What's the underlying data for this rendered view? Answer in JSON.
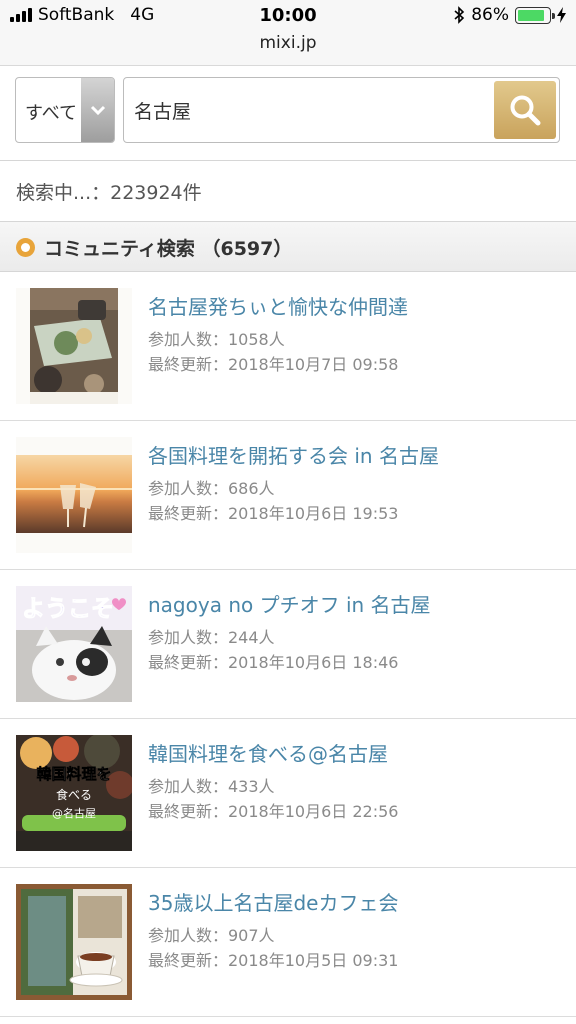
{
  "status_bar": {
    "carrier": "SoftBank",
    "network": "4G",
    "time": "10:00",
    "battery": "86%",
    "battery_level": 0.86,
    "url": "mixi.jp"
  },
  "search": {
    "scope": "すべて",
    "query": "名古屋",
    "icons": {
      "dropdown": "chevron-down-icon",
      "search": "magnifier-icon"
    }
  },
  "result_count": "検索中...：223924件",
  "section": {
    "title": "コミュニティ検索 （6597）"
  },
  "communities": [
    {
      "title": "名古屋発ちぃと愉快な仲間達",
      "members": "参加人数：1058人",
      "updated": "最終更新：2018年10月7日 09:58"
    },
    {
      "title": "各国料理を開拓する会 in 名古屋",
      "members": "参加人数：686人",
      "updated": "最終更新：2018年10月6日 19:53"
    },
    {
      "title": "nagoya no プチオフ in 名古屋",
      "members": "参加人数：244人",
      "updated": "最終更新：2018年10月6日 18:46"
    },
    {
      "title": "韓国料理を食べる@名古屋",
      "members": "参加人数：433人",
      "updated": "最終更新：2018年10月6日 22:56"
    },
    {
      "title": "35歳以上名古屋deカフェ会",
      "members": "参加人数：907人",
      "updated": "最終更新：2018年10月5日 09:31"
    }
  ],
  "thumbnail_text": {
    "welcome": "ようこそ",
    "korean_line1": "韓国料理を",
    "korean_line2": "食べる",
    "korean_line3": "@名古屋"
  },
  "colors": {
    "link": "#4a86a8",
    "accent_gold": "#c9a35c",
    "section_dot": "#e8a43a",
    "battery": "#4cd964"
  }
}
